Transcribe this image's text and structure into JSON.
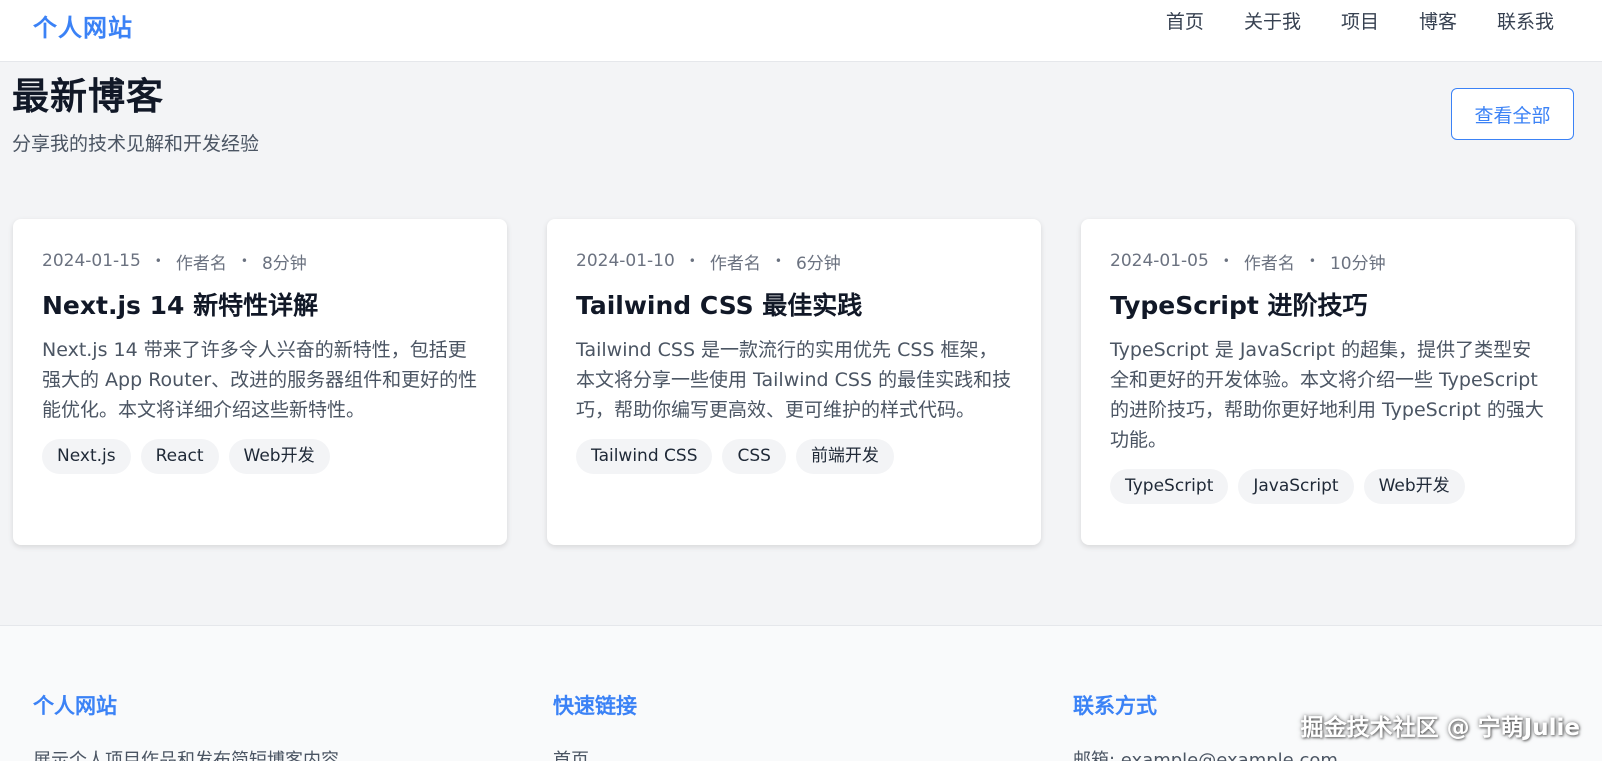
{
  "header": {
    "logo": "个人网站",
    "nav": [
      "首页",
      "关于我",
      "项目",
      "博客",
      "联系我"
    ]
  },
  "blog": {
    "title": "最新博客",
    "subtitle": "分享我的技术见解和开发经验",
    "view_all": "查看全部",
    "posts": [
      {
        "date": "2024-01-15",
        "author": "作者名",
        "read_time": "8分钟",
        "title": "Next.js 14 新特性详解",
        "excerpt": "Next.js 14 带来了许多令人兴奋的新特性，包括更强大的 App Router、改进的服务器组件和更好的性能优化。本文将详细介绍这些新特性。",
        "tags": [
          "Next.js",
          "React",
          "Web开发"
        ]
      },
      {
        "date": "2024-01-10",
        "author": "作者名",
        "read_time": "6分钟",
        "title": "Tailwind CSS 最佳实践",
        "excerpt": "Tailwind CSS 是一款流行的实用优先 CSS 框架，本文将分享一些使用 Tailwind CSS 的最佳实践和技巧，帮助你编写更高效、更可维护的样式代码。",
        "tags": [
          "Tailwind CSS",
          "CSS",
          "前端开发"
        ]
      },
      {
        "date": "2024-01-05",
        "author": "作者名",
        "read_time": "10分钟",
        "title": "TypeScript 进阶技巧",
        "excerpt": "TypeScript 是 JavaScript 的超集，提供了类型安全和更好的开发体验。本文将介绍一些 TypeScript 的进阶技巧，帮助你更好地利用 TypeScript 的强大功能。",
        "tags": [
          "TypeScript",
          "JavaScript",
          "Web开发"
        ]
      }
    ]
  },
  "footer": {
    "brand": {
      "title": "个人网站",
      "text": "展示个人项目作品和发布简短博客内容"
    },
    "links": {
      "title": "快速链接",
      "first": "首页"
    },
    "contact": {
      "title": "联系方式",
      "email": "邮箱: example@example.com"
    }
  },
  "watermark": "掘金技术社区 @ 宁萌Julie",
  "colors": {
    "accent": "#3b82f6",
    "background": "#f3f4f6"
  }
}
